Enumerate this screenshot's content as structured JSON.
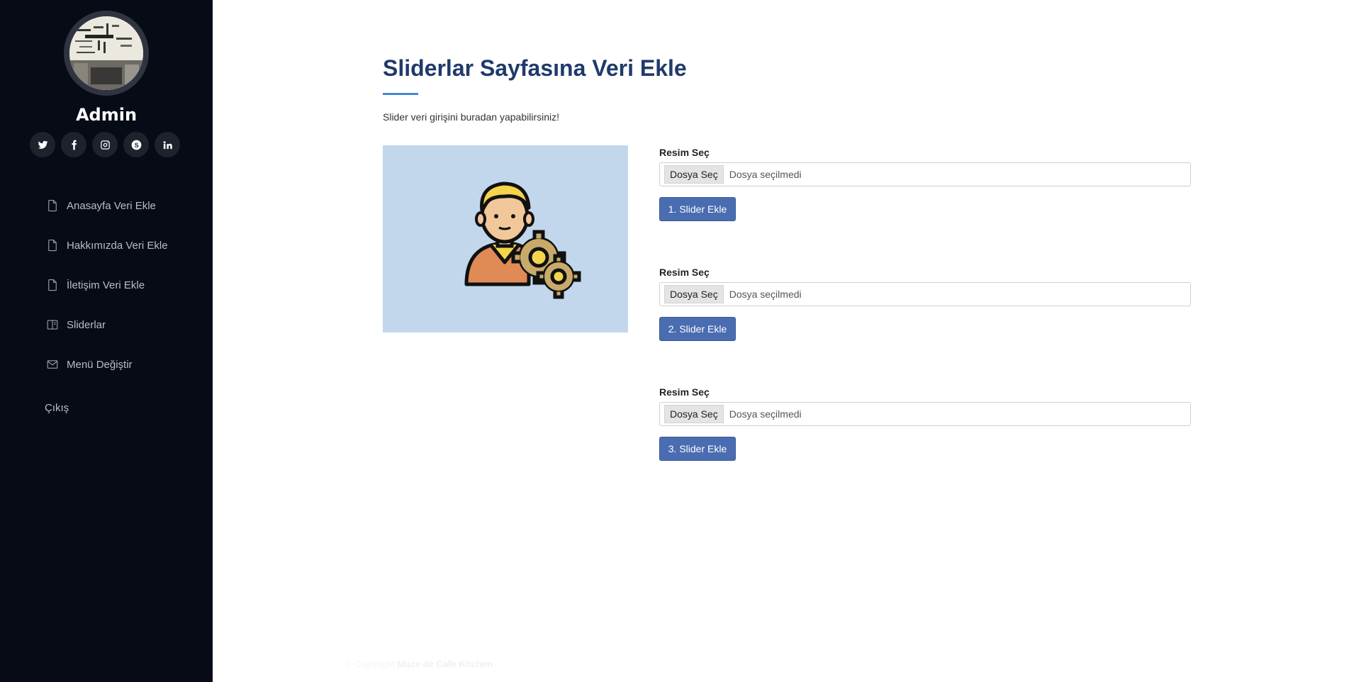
{
  "sidebar": {
    "admin_name": "Admin",
    "socials": [
      "twitter-icon",
      "facebook-icon",
      "instagram-icon",
      "skype-icon",
      "linkedin-icon"
    ],
    "items": [
      {
        "label": "Anasayfa Veri Ekle",
        "icon": "file-icon"
      },
      {
        "label": "Hakkımızda Veri Ekle",
        "icon": "file-icon"
      },
      {
        "label": "İletişim Veri Ekle",
        "icon": "file-icon"
      },
      {
        "label": "Sliderlar",
        "icon": "book-icon"
      },
      {
        "label": "Menü Değiştir",
        "icon": "envelope-icon"
      }
    ],
    "logout": "Çıkış"
  },
  "main": {
    "title": "Sliderlar Sayfasına Veri Ekle",
    "subtitle": "Slider veri girişini buradan yapabilirsiniz!",
    "forms": [
      {
        "label": "Resim Seç",
        "file_button": "Dosya Seç",
        "file_status": "Dosya seçilmedi",
        "submit": "1. Slider Ekle"
      },
      {
        "label": "Resim Seç",
        "file_button": "Dosya Seç",
        "file_status": "Dosya seçilmedi",
        "submit": "2. Slider Ekle"
      },
      {
        "label": "Resim Seç",
        "file_button": "Dosya Seç",
        "file_status": "Dosya seçilmedi",
        "submit": "3. Slider Ekle"
      }
    ]
  },
  "footer": {
    "copyright_prefix": "© Copyright",
    "brand": "Muze de Cafe Kitchen"
  },
  "colors": {
    "sidebar_bg": "#060b16",
    "title": "#1f3a6b",
    "accent": "#4a86cf",
    "button": "#4a6cb0",
    "preview_bg": "#c2d7ec"
  }
}
